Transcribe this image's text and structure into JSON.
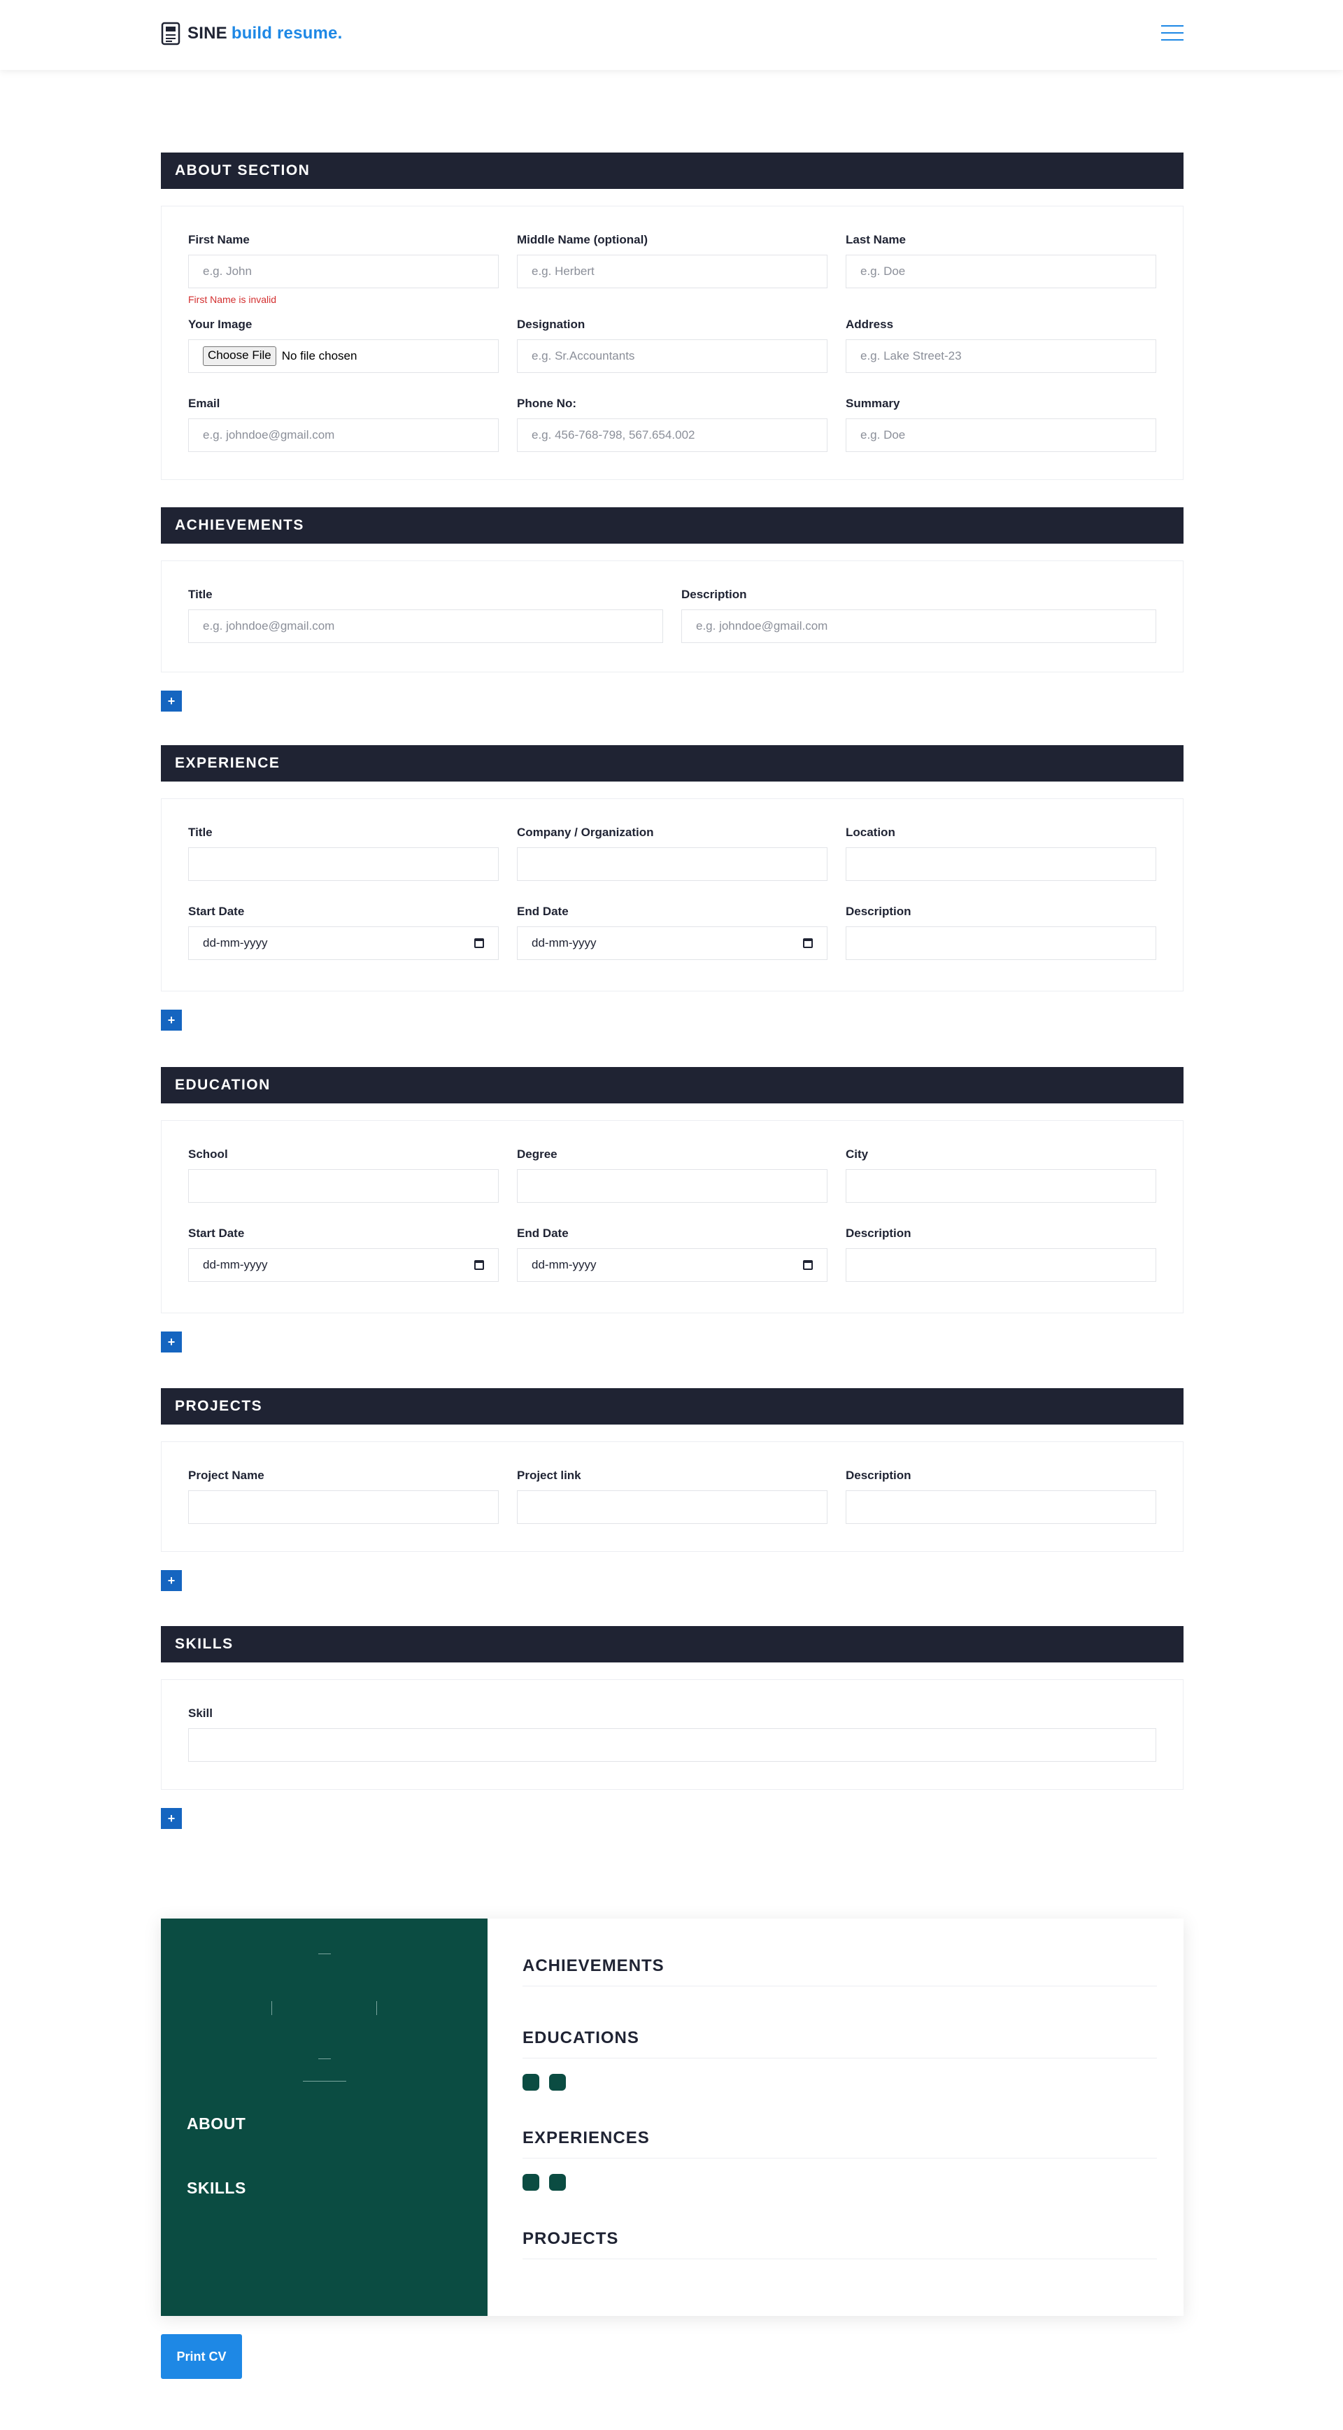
{
  "header": {
    "brand_main": "SINE",
    "brand_accent": "build resume.",
    "accent_color": "#1e88e5",
    "dark_color": "#1f2333"
  },
  "about": {
    "title": "ABOUT SECTION",
    "first_name": {
      "label": "First Name",
      "placeholder": "e.g. John",
      "error": "First Name is invalid"
    },
    "middle_name": {
      "label": "Middle Name (optional)",
      "placeholder": "e.g. Herbert"
    },
    "last_name": {
      "label": "Last Name",
      "placeholder": "e.g. Doe"
    },
    "image": {
      "label": "Your Image",
      "button": "Choose File",
      "status": "No file chosen"
    },
    "designation": {
      "label": "Designation",
      "placeholder": "e.g. Sr.Accountants"
    },
    "address": {
      "label": "Address",
      "placeholder": "e.g. Lake Street-23"
    },
    "email": {
      "label": "Email",
      "placeholder": "e.g. johndoe@gmail.com"
    },
    "phone": {
      "label": "Phone No:",
      "placeholder": "e.g. 456-768-798, 567.654.002"
    },
    "summary": {
      "label": "Summary",
      "placeholder": "e.g. Doe"
    }
  },
  "achievements": {
    "title": "ACHIEVEMENTS",
    "title_field": {
      "label": "Title",
      "placeholder": "e.g. johndoe@gmail.com"
    },
    "description": {
      "label": "Description",
      "placeholder": "e.g. johndoe@gmail.com"
    },
    "add": "+"
  },
  "experience": {
    "title": "EXPERIENCE",
    "title_field": "Title",
    "company": "Company / Organization",
    "location": "Location",
    "start_date": "Start Date",
    "end_date": "End Date",
    "description": "Description",
    "date_placeholder": "dd-mm-yyyy",
    "add": "+"
  },
  "education": {
    "title": "EDUCATION",
    "school": "School",
    "degree": "Degree",
    "city": "City",
    "start_date": "Start Date",
    "end_date": "End Date",
    "description": "Description",
    "date_placeholder": "dd-mm-yyyy",
    "add": "+"
  },
  "projects": {
    "title": "PROJECTS",
    "name": "Project Name",
    "link": "Project link",
    "description": "Description",
    "add": "+"
  },
  "skills": {
    "title": "SKILLS",
    "skill": "Skill",
    "add": "+"
  },
  "preview": {
    "left_bg": "#0b4c42",
    "about": "ABOUT",
    "skills": "SKILLS",
    "achievements": "ACHIEVEMENTS",
    "educations": "EDUCATIONS",
    "experiences": "EXPERIENCES",
    "projects": "PROJECTS"
  },
  "actions": {
    "print": "Print CV"
  }
}
